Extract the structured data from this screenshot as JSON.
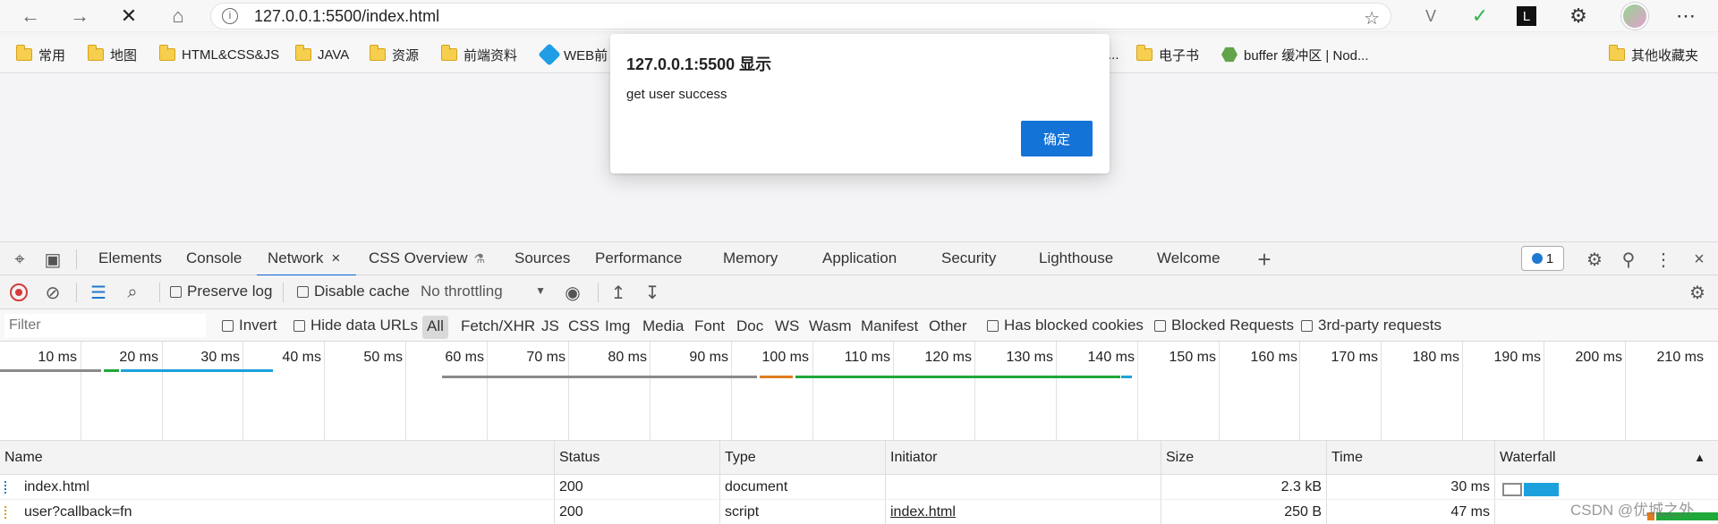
{
  "browser": {
    "url": "127.0.0.1:5500/index.html",
    "icons": {
      "back": "←",
      "forward": "→",
      "stop": "✕",
      "home": "⌂",
      "info": "i",
      "favorite": "☆",
      "extension_v": "V",
      "shield": "✓",
      "extension_l": "L",
      "puzzle": "⚙",
      "menu": "⋯"
    }
  },
  "bookmarks": [
    {
      "label": "常用"
    },
    {
      "label": "地图"
    },
    {
      "label": "HTML&CSS&JS"
    },
    {
      "label": "JAVA"
    },
    {
      "label": "资源"
    },
    {
      "label": "前端资料"
    },
    {
      "label": "WEB前"
    },
    {
      "label": "..."
    },
    {
      "label": "电子书"
    },
    {
      "label": "buffer 缓冲区 | Nod..."
    },
    {
      "label": "其他收藏夹"
    }
  ],
  "dialog": {
    "title": "127.0.0.1:5500 显示",
    "message": "get user success",
    "ok_label": "确定"
  },
  "devtools": {
    "tabs": [
      "Elements",
      "Console",
      "Network",
      "CSS Overview",
      "Sources",
      "Performance",
      "Memory",
      "Application",
      "Security",
      "Lighthouse",
      "Welcome"
    ],
    "active_tab": "Network",
    "messages_count": "1",
    "toolbar": {
      "preserve_log": "Preserve log",
      "disable_cache": "Disable cache",
      "throttling": "No throttling"
    },
    "filter": {
      "placeholder": "Filter",
      "invert": "Invert",
      "hide_data_urls": "Hide data URLs",
      "types": [
        "All",
        "Fetch/XHR",
        "JS",
        "CSS",
        "Img",
        "Media",
        "Font",
        "Doc",
        "WS",
        "Wasm",
        "Manifest",
        "Other"
      ],
      "has_blocked_cookies": "Has blocked cookies",
      "blocked_requests": "Blocked Requests",
      "third_party_requests": "3rd-party requests"
    },
    "timeline_labels": [
      "10 ms",
      "20 ms",
      "30 ms",
      "40 ms",
      "50 ms",
      "60 ms",
      "70 ms",
      "80 ms",
      "90 ms",
      "100 ms",
      "110 ms",
      "120 ms",
      "130 ms",
      "140 ms",
      "150 ms",
      "160 ms",
      "170 ms",
      "180 ms",
      "190 ms",
      "200 ms",
      "210 ms"
    ],
    "columns": {
      "name": "Name",
      "status": "Status",
      "type": "Type",
      "initiator": "Initiator",
      "size": "Size",
      "time": "Time",
      "waterfall": "Waterfall",
      "sort_icon": "▲"
    },
    "rows": [
      {
        "name": "index.html",
        "status": "200",
        "type": "document",
        "initiator": "",
        "size": "2.3 kB",
        "time": "30 ms"
      },
      {
        "name": "user?callback=fn",
        "status": "200",
        "type": "script",
        "initiator": "index.html",
        "size": "250 B",
        "time": "47 ms"
      }
    ],
    "colors": {
      "accent": "#0b62d6",
      "record": "#d63a3a",
      "waiting": "#8a8a8a",
      "receive": "#1da1dc",
      "download": "#20a83a",
      "queue": "#e07c20"
    }
  },
  "watermark": "CSDN @优城之外"
}
